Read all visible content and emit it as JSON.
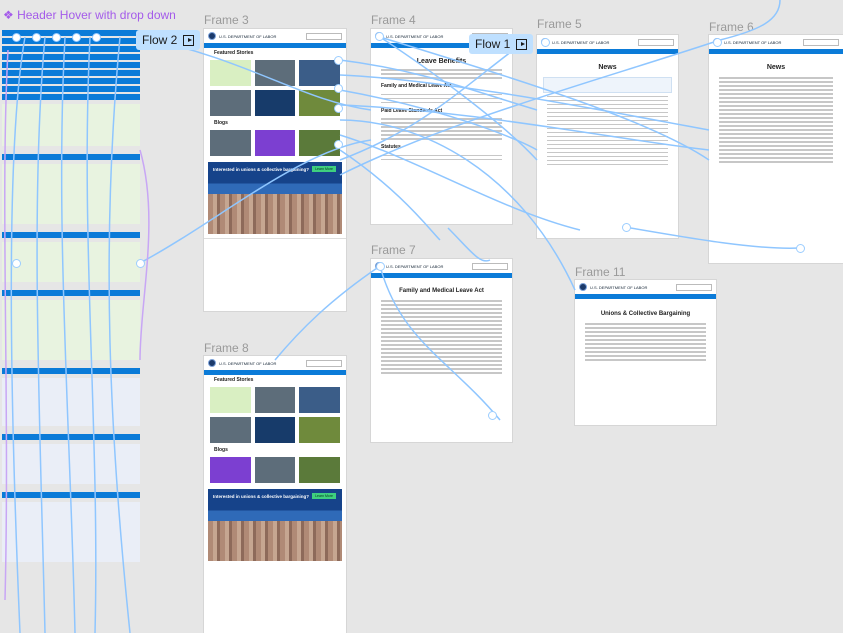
{
  "component": {
    "label": "❖ Header Hover with drop down"
  },
  "frames": [
    {
      "id": "frame3",
      "label": "Frame 3",
      "page_title": "",
      "site": "U.S. DEPARTMENT OF LABOR",
      "sections": [
        "Featured Stories",
        "Blogs"
      ],
      "banner_title": "Interested in unions & collective bargaining?",
      "banner_button": "Learn More"
    },
    {
      "id": "frame4",
      "label": "Frame 4",
      "page_title": "Leave Benefits",
      "site": "U.S. DEPARTMENT OF LABOR",
      "sections": [
        "Family and Medical Leave Act",
        "Paid Leave Standards Act",
        "Statutes"
      ]
    },
    {
      "id": "frame5",
      "label": "Frame 5",
      "page_title": "News",
      "site": "U.S. DEPARTMENT OF LABOR"
    },
    {
      "id": "frame6",
      "label": "Frame 6",
      "page_title": "News",
      "site": "U.S. DEPARTMENT OF LABOR"
    },
    {
      "id": "frame7",
      "label": "Frame 7",
      "page_title": "Family and Medical Leave Act",
      "site": "U.S. DEPARTMENT OF LABOR"
    },
    {
      "id": "frame8",
      "label": "Frame 8",
      "page_title": "",
      "site": "U.S. DEPARTMENT OF LABOR",
      "sections": [
        "Featured Stories",
        "Blogs"
      ],
      "banner_title": "Interested in unions & collective bargaining?",
      "banner_button": "Learn More"
    },
    {
      "id": "frame11",
      "label": "Frame 11",
      "page_title": "Unions & Collective Bargaining",
      "site": "U.S. DEPARTMENT OF LABOR"
    }
  ],
  "flows": [
    {
      "label": "Flow 2"
    },
    {
      "label": "Flow 1"
    }
  ],
  "colors": {
    "canvas": "#e6e6e6",
    "accent": "#0b7bd8",
    "wire": "#8fc6ff",
    "component": "#a45bea",
    "flow_badge": "#bfe0ff"
  }
}
